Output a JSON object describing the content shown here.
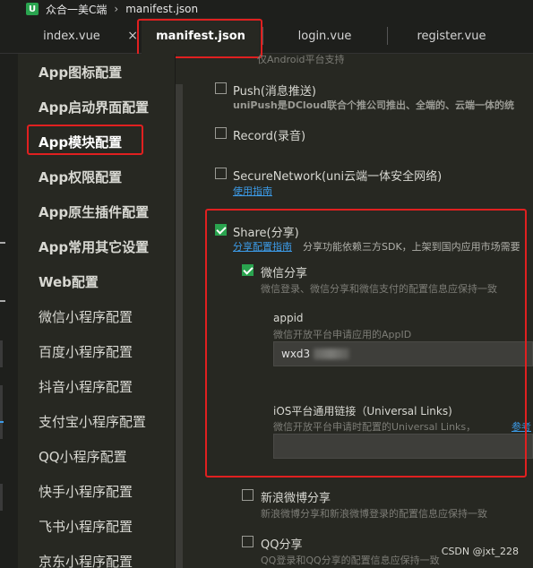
{
  "titlebar": {
    "logo": "U",
    "breadcrumb": [
      "众合一美C端",
      "manifest.json"
    ]
  },
  "tabs": [
    {
      "label": "index.vue",
      "close": "×"
    },
    {
      "label": "manifest.json"
    },
    {
      "label": "login.vue"
    },
    {
      "label": "register.vue"
    }
  ],
  "sidebar": {
    "items": [
      {
        "label": "App图标配置"
      },
      {
        "label": "App启动界面配置"
      },
      {
        "label": "App模块配置"
      },
      {
        "label": "App权限配置"
      },
      {
        "label": "App原生插件配置"
      },
      {
        "label": "App常用其它设置"
      },
      {
        "label": "Web配置"
      },
      {
        "label": "微信小程序配置"
      },
      {
        "label": "百度小程序配置"
      },
      {
        "label": "抖音小程序配置"
      },
      {
        "label": "支付宝小程序配置"
      },
      {
        "label": "QQ小程序配置"
      },
      {
        "label": "快手小程序配置"
      },
      {
        "label": "飞书小程序配置"
      },
      {
        "label": "京东小程序配置"
      }
    ],
    "selected": "App模块配置"
  },
  "main": {
    "top_desc": "仅Android平台支持",
    "push": {
      "label": "Push(消息推送)",
      "desc": "uniPush是DCloud联合个推公司推出、全端的、云端一体的统"
    },
    "record": {
      "label": "Record(录音)"
    },
    "secure": {
      "label": "SecureNetwork(uni云端一体安全网络)",
      "link": "使用指南"
    },
    "share": {
      "label": "Share(分享)",
      "link": "分享配置指南",
      "desc": "分享功能依赖三方SDK，上架到国内应用市场需要"
    },
    "wechat": {
      "label": "微信分享",
      "desc": "微信登录、微信分享和微信支付的配置信息应保持一致",
      "appid_label": "appid",
      "appid_desc": "微信开放平台申请应用的AppID",
      "appid_value": "wxd3",
      "ul_label": "iOS平台通用链接（Universal Links)",
      "ul_desc": "微信开放平台申请时配置的Universal Links，",
      "ul_link": "参考"
    },
    "sina": {
      "label": "新浪微博分享",
      "desc": "新浪微博分享和新浪微博登录的配置信息应保持一致"
    },
    "qq": {
      "label": "QQ分享",
      "desc": "QQ登录和QQ分享的配置信息应保持一致"
    }
  },
  "watermark": "CSDN @jxt_228",
  "colors": {
    "accent_green": "#2aa44f",
    "highlight_red": "#e02020",
    "link_blue": "#3c9be8"
  }
}
